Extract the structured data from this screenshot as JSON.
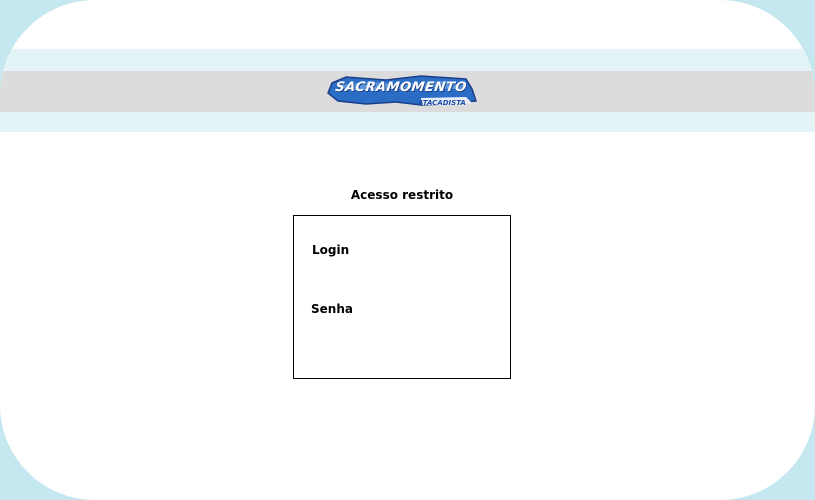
{
  "header": {
    "logo": {
      "icon": "sacramomento-logo",
      "wordmark": "SACRAMOMENTO",
      "subtitle": "ATACADISTA",
      "colors": {
        "primary": "#2b6cc4",
        "dark": "#1c3f8a",
        "light": "#7fb2e8"
      }
    }
  },
  "login": {
    "title": "Acesso restrito",
    "login_label": "Login",
    "password_label": "Senha"
  },
  "colors": {
    "outer_background": "#c5e7ef",
    "band_light": "#e4f3f6",
    "band_gray": "#dcdcdc"
  }
}
